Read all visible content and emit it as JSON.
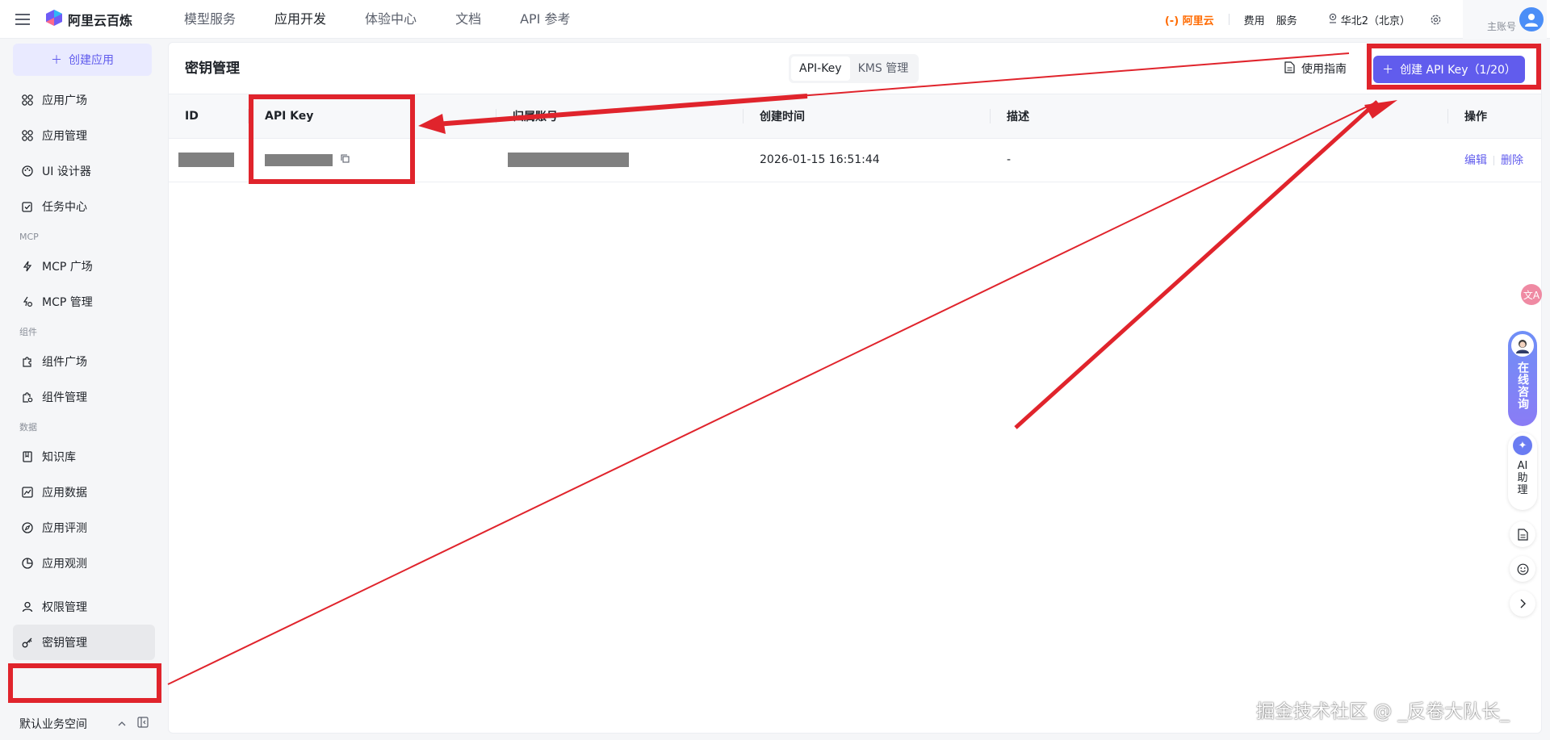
{
  "topbar": {
    "brand": "阿里云百炼",
    "nav": [
      "模型服务",
      "应用开发",
      "体验中心",
      "文档",
      "API 参考"
    ],
    "aliyun_logo": "(-) 阿里云",
    "links": [
      "费用",
      "服务"
    ],
    "region": "华北2（北京）",
    "account_label": "主账号"
  },
  "sidebar": {
    "create_app": "创建应用",
    "groups": [
      {
        "section": "",
        "items": [
          "应用广场",
          "应用管理",
          "UI 设计器",
          "任务中心"
        ]
      },
      {
        "section": "MCP",
        "items": [
          "MCP 广场",
          "MCP 管理"
        ]
      },
      {
        "section": "组件",
        "items": [
          "组件广场",
          "组件管理"
        ]
      },
      {
        "section": "数据",
        "items": [
          "知识库",
          "应用数据",
          "应用评测",
          "应用观测"
        ]
      }
    ],
    "bottom_items": [
      "权限管理",
      "密钥管理"
    ],
    "active_item": "密钥管理",
    "workspace": "默认业务空间"
  },
  "main": {
    "title": "密钥管理",
    "tabs": [
      "API-Key",
      "KMS 管理"
    ],
    "active_tab": "API-Key",
    "guide": "使用指南",
    "create_button": "创建 API Key（1/20）",
    "table": {
      "columns": [
        "ID",
        "API Key",
        "归属账号",
        "创建时间",
        "描述",
        "操作"
      ],
      "rows": [
        {
          "created": "2026-01-15 16:51:44",
          "description": "-",
          "edit": "编辑",
          "delete": "删除"
        }
      ]
    }
  },
  "floating": {
    "translate": "文A",
    "consult": "在线咨询",
    "ai_helper": "AI 助理"
  },
  "watermark": "掘金技术社区 @ _反卷大队长_",
  "colors": {
    "accent": "#615ced",
    "annotation": "#e0242c",
    "aliyun_orange": "#ff6a00"
  }
}
